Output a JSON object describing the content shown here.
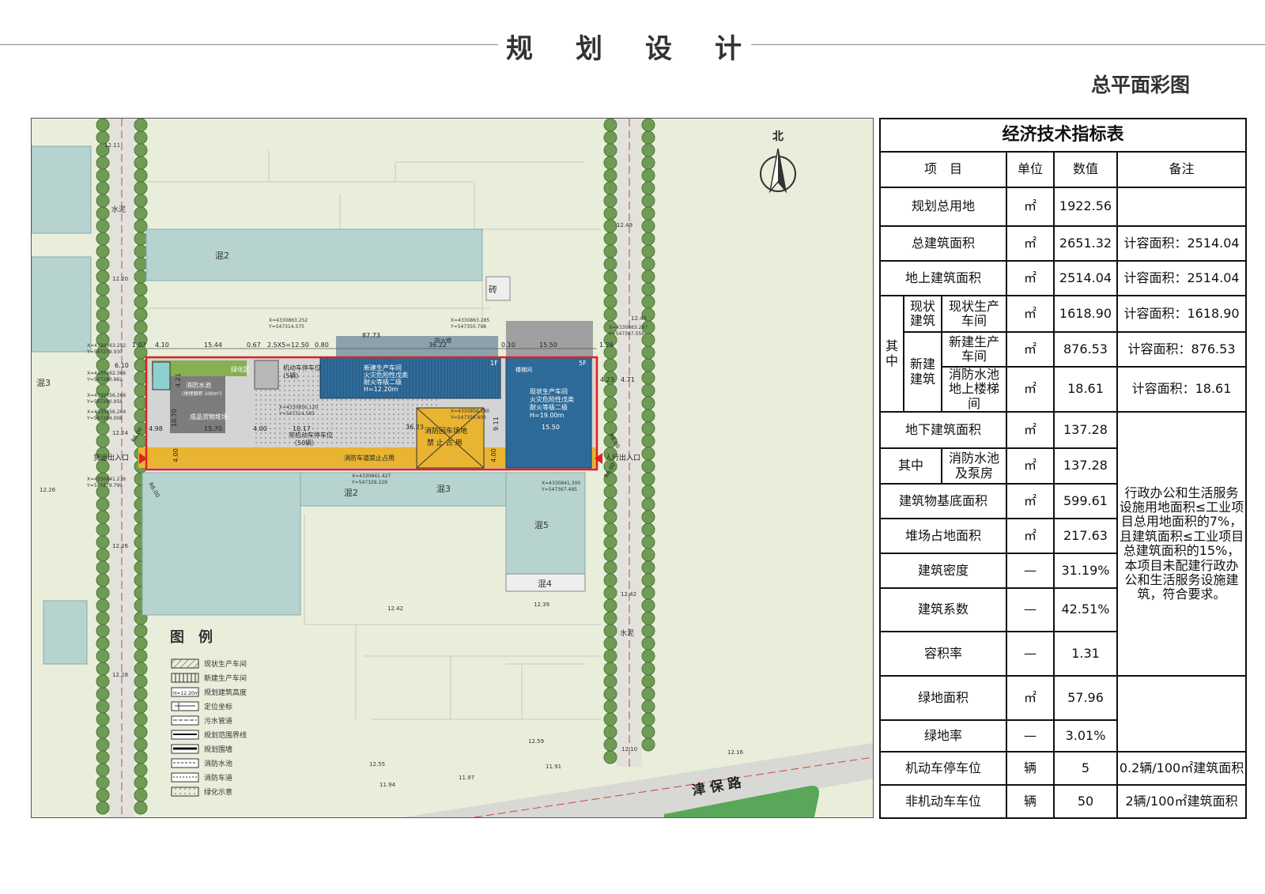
{
  "page": {
    "title_chars": [
      "规",
      "划",
      "设",
      "计"
    ],
    "subtitle": "总平面彩图"
  },
  "table": {
    "title": "经济技术指标表",
    "headers": {
      "item": "项　目",
      "unit": "单位",
      "value": "数值",
      "note": "备注"
    },
    "rows": {
      "r1": {
        "item": "规划总用地",
        "unit": "㎡",
        "value": "1922.56",
        "note": ""
      },
      "r2": {
        "item": "总建筑面积",
        "unit": "㎡",
        "value": "2651.32",
        "note": "计容面积：2514.04"
      },
      "r3": {
        "item": "地上建筑面积",
        "unit": "㎡",
        "value": "2514.04",
        "note": "计容面积：2514.04"
      },
      "r4": {
        "group": "其中",
        "sub": "现状建筑",
        "item": "现状生产车间",
        "unit": "㎡",
        "value": "1618.90",
        "note": "计容面积：1618.90"
      },
      "r5": {
        "sub": "新建建筑",
        "item": "新建生产车间",
        "unit": "㎡",
        "value": "876.53",
        "note": "计容面积：876.53"
      },
      "r6": {
        "item": "消防水池地上楼梯间",
        "unit": "㎡",
        "value": "18.61",
        "note": "计容面积：18.61"
      },
      "r7": {
        "item": "地下建筑面积",
        "unit": "㎡",
        "value": "137.28"
      },
      "r8": {
        "group": "其中",
        "item": "消防水池及泵房",
        "unit": "㎡",
        "value": "137.28"
      },
      "r9": {
        "item": "建筑物基底面积",
        "unit": "㎡",
        "value": "599.61"
      },
      "r10": {
        "item": "堆场占地面积",
        "unit": "㎡",
        "value": "217.63"
      },
      "r11": {
        "item": "建筑密度",
        "unit": "—",
        "value": "31.19%"
      },
      "r12": {
        "item": "建筑系数",
        "unit": "—",
        "value": "42.51%"
      },
      "r13": {
        "item": "容积率",
        "unit": "—",
        "value": "1.31"
      },
      "r14": {
        "item": "绿地面积",
        "unit": "㎡",
        "value": "57.96"
      },
      "r15": {
        "item": "绿地率",
        "unit": "—",
        "value": "3.01%"
      },
      "r16": {
        "item": "机动车停车位",
        "unit": "辆",
        "value": "5",
        "note": "0.2辆/100㎡建筑面积"
      },
      "r17": {
        "item": "非机动车车位",
        "unit": "辆",
        "value": "50",
        "note": "2辆/100㎡建筑面积"
      }
    },
    "merged_note": "行政办公和生活服务设施用地面积≤工业项目总用地面积的7%，且建筑面积≤工业项目总建筑面积的15%，本项目未配建行政办公和生活服务设施建筑，符合要求。"
  },
  "map": {
    "north": "北",
    "road": "津 保 路",
    "legend_title": "图　例",
    "legend": [
      "现状生产车间",
      "新建生产车间",
      "规划建筑高度",
      "定位坐标",
      "污水管道",
      "规划范围界线",
      "规划围墙",
      "消防水池",
      "消防车道",
      "绿化示意"
    ],
    "legend_height_sample": "H=12.20m",
    "blocks": {
      "hun2": "混2",
      "hun2b": "混2",
      "hun3a": "混3",
      "hun3b": "混3",
      "hun5": "混5",
      "hun4": "混4",
      "zhuan": "砖",
      "shuini_a": "水泥",
      "shuini_b": "水泥"
    },
    "gates": {
      "cargo": "货运出入口",
      "pedestrian": "人行出入口"
    },
    "site_labels": {
      "fire_pool": "消防水池",
      "fire_pool_area": "(地埋面积 100m²)",
      "green": "绿化区",
      "parking": "机动车停车位",
      "parking_count": "(5辆)",
      "storage": "成品货物堆场",
      "bike": "非机动车停车位",
      "bike_count": "（50辆）",
      "fire_yard": "消防回车场地",
      "fire_yard_sub": "禁 止 占 用",
      "new_bldg": [
        "新建生产车间",
        "火灾危险性戊类",
        "耐火等级二级",
        "H=12.20m"
      ],
      "old_bldg": [
        "现状生产车间",
        "火灾危险性戊类",
        "耐火等级二级",
        "H=19.00m"
      ],
      "lane": "消防车道禁止占用",
      "roof_a": "1F",
      "roof_b": "5F",
      "fire_wall": "防火墙",
      "stair": "楼梯间",
      "old_width": "15.50"
    },
    "dims": {
      "d1": "4.10",
      "d2": "15.44",
      "d3": "0.67",
      "d4": "2.5X5=12.50",
      "d5": "0.80",
      "d6": "87.73",
      "d7": "36.22",
      "d8": "0.10",
      "d9": "15.50",
      "d10": "1.26",
      "d11": "15.70",
      "d12": "4.98",
      "d13": "10.70",
      "d14": "4.00",
      "d15": "10.17",
      "d16": "36.23",
      "d17": "4.00",
      "d18": "4.00",
      "d19": "9.11",
      "d20": "6.10",
      "d21": "1.03",
      "d22": "4.21",
      "d23": "4.71",
      "d24": "4.23",
      "r1": "R6.00",
      "r2": "R6.00",
      "r3": "R6.00",
      "r4": "R6.00"
    },
    "coords": {
      "c1": "X=4330863.252",
      "c1y": "Y=547314.575",
      "c2": "X=4330863.285",
      "c2y": "Y=547350.798",
      "c3": "X=4330863.297",
      "c3y": "Y=547367.556",
      "c4": "X=4330856.120",
      "c4y": "Y=547314.583",
      "c5": "X=4330856.180",
      "c5y": "Y=547350.803",
      "c6": "X=4330841.427",
      "c6y": "Y=547329.229",
      "c7": "X=4330841.300",
      "c7y": "Y=547367.495",
      "c8": "X=4330863.252",
      "c8y": "Y=547279.930",
      "c9": "X=4330862.366",
      "c9y": "Y=547280.962",
      "c10": "X=4330856.266",
      "c10y": "Y=547280.958",
      "c11": "X=4330856.264",
      "c11y": "Y=547284.008",
      "c12": "X=4330841.236",
      "c12y": "Y=547279.799"
    },
    "elev": {
      "e1": "12.11",
      "e2": "12.20",
      "e3": "12.24",
      "e4": "12.26",
      "e5": "12.26",
      "e6": "12.28",
      "e7": "12.49",
      "e8": "12.45",
      "e9": "12.42",
      "e10": "12.42",
      "e11": "12.39",
      "e12": "12.59",
      "e13": "12.55",
      "e14": "11.94",
      "e15": "11.97",
      "e16": "11.91",
      "e17": "12.10",
      "e18": "12.16"
    }
  }
}
